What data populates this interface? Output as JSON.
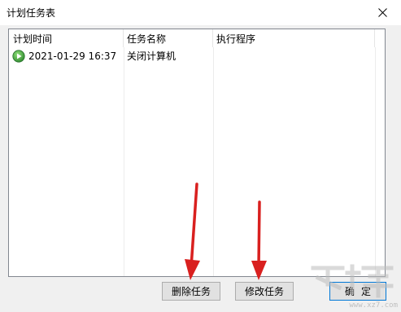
{
  "window": {
    "title": "计划任务表",
    "close_icon": "close-icon"
  },
  "table": {
    "columns": [
      "计划时间",
      "任务名称",
      "执行程序"
    ],
    "rows": [
      {
        "status_icon": "play-icon",
        "time": "2021-01-29 16:37",
        "task": "关闭计算机",
        "program": ""
      }
    ]
  },
  "buttons": {
    "delete": "删除任务",
    "modify": "修改任务",
    "ok": "确定"
  },
  "watermark": {
    "text": "www.xz7.com"
  },
  "colors": {
    "annotation_arrow": "#d9201f",
    "play_icon": "#3ca23c"
  }
}
